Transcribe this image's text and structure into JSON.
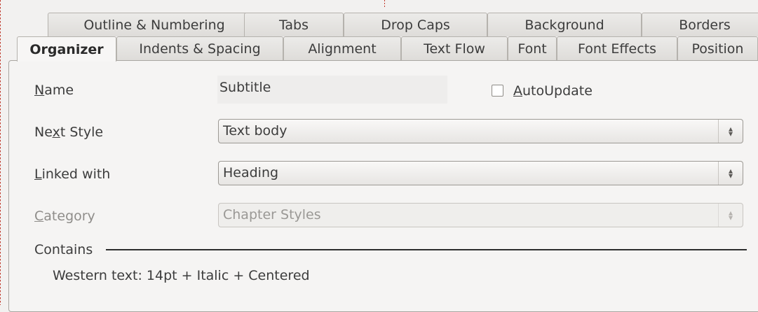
{
  "tabs": {
    "row1": [
      "Outline & Numbering",
      "Tabs",
      "Drop Caps",
      "Background",
      "Borders"
    ],
    "row2": [
      "Organizer",
      "Indents & Spacing",
      "Alignment",
      "Text Flow",
      "Font",
      "Font Effects",
      "Position"
    ],
    "active": "Organizer"
  },
  "organizer": {
    "name_label": {
      "pre": "",
      "mnemonic": "N",
      "post": "ame"
    },
    "name_value": "Subtitle",
    "autoupdate_label": {
      "pre": "",
      "mnemonic": "A",
      "post": "utoUpdate"
    },
    "autoupdate_checked": false,
    "next_style_label": {
      "pre": "Ne",
      "mnemonic": "x",
      "post": "t Style"
    },
    "next_style_value": "Text body",
    "linked_with_label": {
      "pre": "",
      "mnemonic": "L",
      "post": "inked with"
    },
    "linked_with_value": "Heading",
    "category_label": {
      "pre": "",
      "mnemonic": "C",
      "post": "ategory"
    },
    "category_value": "Chapter Styles",
    "contains_label": "Contains",
    "contains_text": "Western text: 14pt + Italic + Centered"
  }
}
